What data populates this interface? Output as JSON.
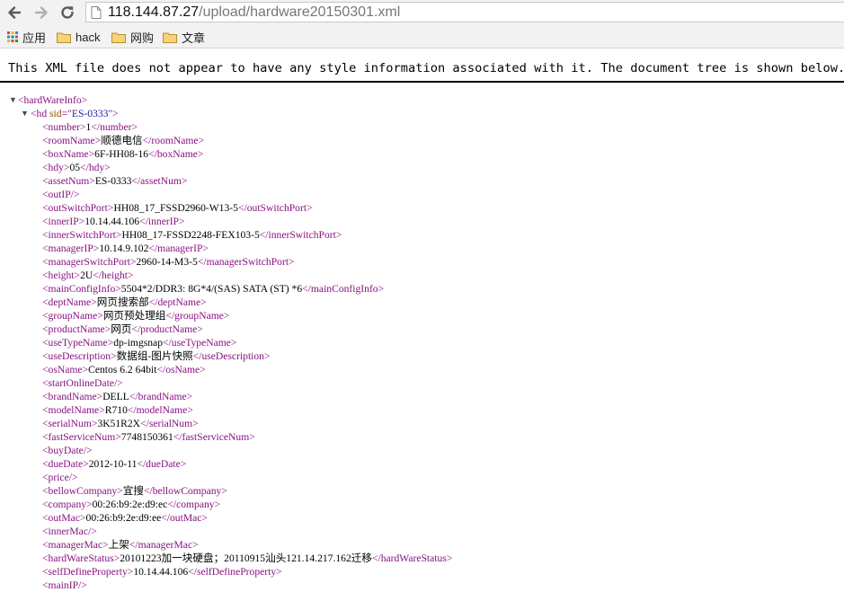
{
  "browser": {
    "url_host": "118.144.87.27",
    "url_path": "/upload/hardware20150301.xml"
  },
  "bookmarks": [
    {
      "label": "应用",
      "icon": "apps-grid-icon"
    },
    {
      "label": "hack",
      "icon": "folder-icon"
    },
    {
      "label": "网购",
      "icon": "folder-icon"
    },
    {
      "label": "文章",
      "icon": "folder-icon"
    }
  ],
  "notice": "This XML file does not appear to have any style information associated with it. The document tree is shown below.",
  "xml": {
    "root_tag": "hardWareInfo",
    "hd_tag": "hd",
    "hd_attr_name": "sid",
    "hd_attr_value": "ES-0333",
    "fields": [
      {
        "tag": "number",
        "value": "1"
      },
      {
        "tag": "roomName",
        "value": "顺德电信"
      },
      {
        "tag": "boxName",
        "value": "6F-HH08-16"
      },
      {
        "tag": "hdy",
        "value": "05"
      },
      {
        "tag": "assetNum",
        "value": "ES-0333"
      },
      {
        "tag": "outIP",
        "value": ""
      },
      {
        "tag": "outSwitchPort",
        "value": "HH08_17_FSSD2960-W13-5"
      },
      {
        "tag": "innerIP",
        "value": "10.14.44.106"
      },
      {
        "tag": "innerSwitchPort",
        "value": "HH08_17-FSSD2248-FEX103-5"
      },
      {
        "tag": "managerIP",
        "value": "10.14.9.102"
      },
      {
        "tag": "managerSwitchPort",
        "value": "2960-14-M3-5"
      },
      {
        "tag": "height",
        "value": "2U"
      },
      {
        "tag": "mainConfigInfo",
        "value": "5504*2/DDR3: 8G*4/(SAS) SATA (ST) *6"
      },
      {
        "tag": "deptName",
        "value": "网页搜索部"
      },
      {
        "tag": "groupName",
        "value": "网页预处理组"
      },
      {
        "tag": "productName",
        "value": "网页"
      },
      {
        "tag": "useTypeName",
        "value": "dp-imgsnap"
      },
      {
        "tag": "useDescription",
        "value": "数据组-图片快照"
      },
      {
        "tag": "osName",
        "value": "Centos 6.2 64bit"
      },
      {
        "tag": "startOnlineDate",
        "value": ""
      },
      {
        "tag": "brandName",
        "value": "DELL"
      },
      {
        "tag": "modelName",
        "value": "R710"
      },
      {
        "tag": "serialNum",
        "value": "3K51R2X"
      },
      {
        "tag": "fastServiceNum",
        "value": "7748150361"
      },
      {
        "tag": "buyDate",
        "value": ""
      },
      {
        "tag": "dueDate",
        "value": "2012-10-11"
      },
      {
        "tag": "price",
        "value": ""
      },
      {
        "tag": "bellowCompany",
        "value": "宜搜"
      },
      {
        "tag": "company",
        "value": "00:26:b9:2e:d9:ec"
      },
      {
        "tag": "outMac",
        "value": "00:26:b9:2e:d9:ee"
      },
      {
        "tag": "innerMac",
        "value": ""
      },
      {
        "tag": "managerMac",
        "value": "上架"
      },
      {
        "tag": "hardWareStatus",
        "value": "20101223加一块硬盘；20110915汕头121.14.217.162迁移"
      },
      {
        "tag": "selfDefineProperty",
        "value": "10.14.44.106"
      },
      {
        "tag": "mainIP",
        "value": ""
      }
    ]
  }
}
